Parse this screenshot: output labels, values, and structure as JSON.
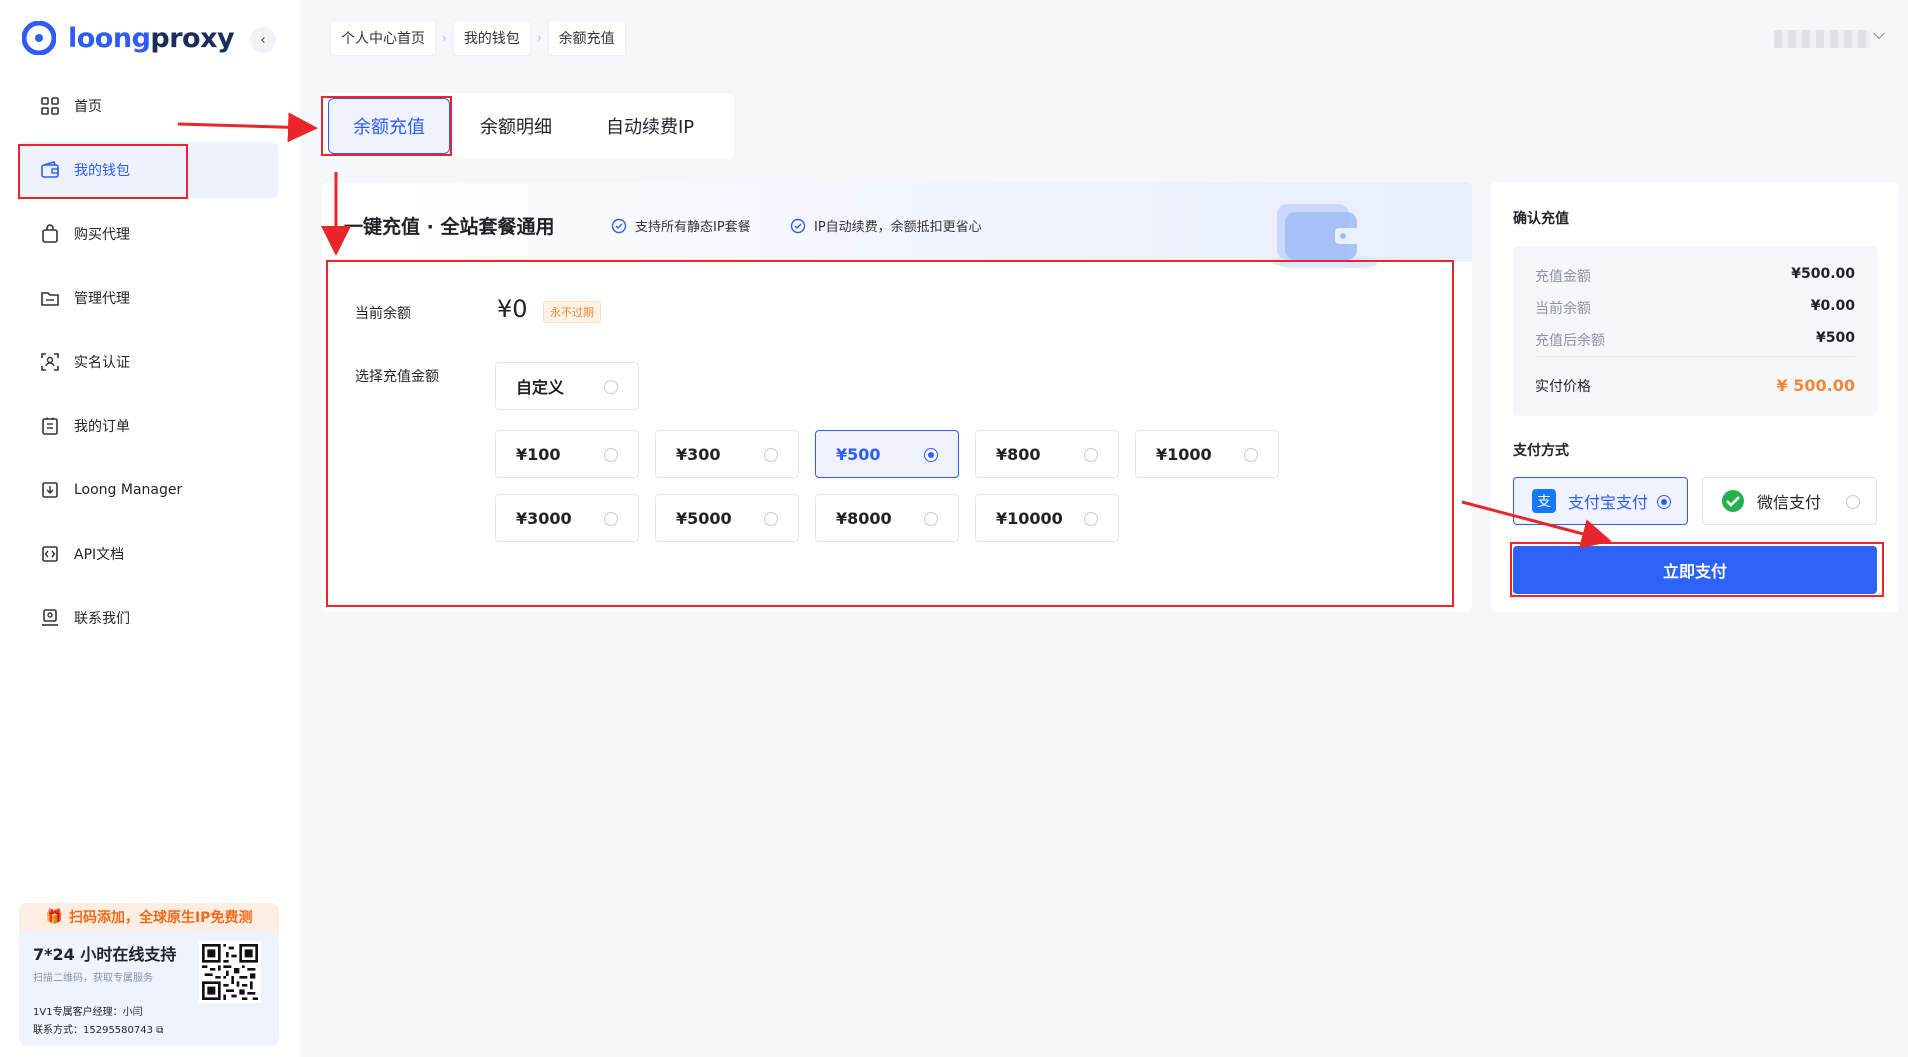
{
  "brand": {
    "name_a": "loong",
    "name_b": "proxy",
    "primary": "#2f5cf5",
    "annotation": "#e8262b"
  },
  "sidebar": {
    "collapse_icon": "chevron-left-icon",
    "items": [
      {
        "label": "首页",
        "icon": "grid-icon",
        "active": false
      },
      {
        "label": "我的钱包",
        "icon": "wallet-icon",
        "active": true
      },
      {
        "label": "购买代理",
        "icon": "bag-icon",
        "active": false
      },
      {
        "label": "管理代理",
        "icon": "folder-icon",
        "active": false
      },
      {
        "label": "实名认证",
        "icon": "face-scan-icon",
        "active": false
      },
      {
        "label": "我的订单",
        "icon": "order-icon",
        "active": false
      },
      {
        "label": "Loong Manager",
        "icon": "download-icon",
        "active": false
      },
      {
        "label": "API文档",
        "icon": "code-doc-icon",
        "active": false
      },
      {
        "label": "联系我们",
        "icon": "contact-icon",
        "active": false
      }
    ],
    "promo": {
      "headline": "扫码添加，全球原生IP免费测",
      "title": "7*24 小时在线支持",
      "subtitle": "扫描二维码，获取专属服务",
      "manager": "1V1专属客户经理：小闫",
      "contact": "联系方式：15295580743"
    }
  },
  "breadcrumb": [
    "个人中心首页",
    "我的钱包",
    "余额充值"
  ],
  "tabs": [
    {
      "label": "余额充值",
      "active": true
    },
    {
      "label": "余额明细",
      "active": false
    },
    {
      "label": "自动续费IP",
      "active": false
    }
  ],
  "recharge": {
    "banner_title": "一键充值 · 全站套餐通用",
    "feature_1": "支持所有静态IP套餐",
    "feature_2": "IP自动续费，余额抵扣更省心",
    "balance_label": "当前余额",
    "balance_value": "¥0",
    "balance_badge": "永不过期",
    "amount_label": "选择充值金额",
    "custom_label": "自定义",
    "amounts": [
      {
        "label": "¥100",
        "selected": false
      },
      {
        "label": "¥300",
        "selected": false
      },
      {
        "label": "¥500",
        "selected": true
      },
      {
        "label": "¥800",
        "selected": false
      },
      {
        "label": "¥1000",
        "selected": false
      },
      {
        "label": "¥3000",
        "selected": false
      },
      {
        "label": "¥5000",
        "selected": false
      },
      {
        "label": "¥8000",
        "selected": false
      },
      {
        "label": "¥10000",
        "selected": false
      }
    ]
  },
  "confirm": {
    "title": "确认充值",
    "rows": [
      {
        "k": "充值金额",
        "v": "¥500.00"
      },
      {
        "k": "当前余额",
        "v": "¥0.00"
      },
      {
        "k": "充值后余额",
        "v": "¥500"
      }
    ],
    "total_label": "实付价格",
    "total_value": "¥ 500.00",
    "pay_title": "支付方式",
    "alipay_label": "支付宝支付",
    "wechat_label": "微信支付",
    "pay_button": "立即支付"
  }
}
